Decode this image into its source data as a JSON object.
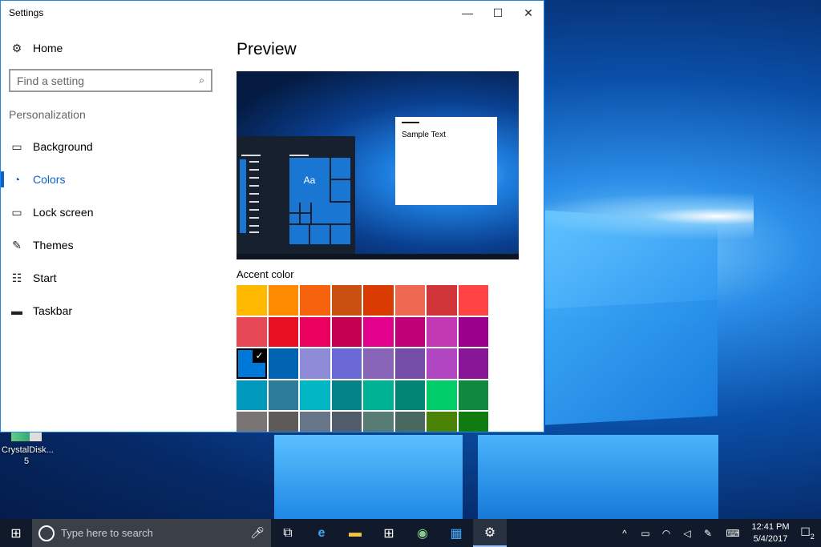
{
  "window": {
    "title": "Settings",
    "minimize": "—",
    "maximize": "☐",
    "close": "✕"
  },
  "sidebar": {
    "home": "Home",
    "search_placeholder": "Find a setting",
    "section": "Personalization",
    "items": [
      {
        "label": "Background",
        "icon": "image-icon"
      },
      {
        "label": "Colors",
        "icon": "palette-icon"
      },
      {
        "label": "Lock screen",
        "icon": "lock-screen-icon"
      },
      {
        "label": "Themes",
        "icon": "brush-icon"
      },
      {
        "label": "Start",
        "icon": "start-icon"
      },
      {
        "label": "Taskbar",
        "icon": "taskbar-icon"
      }
    ],
    "active": "Colors"
  },
  "main": {
    "preview_title": "Preview",
    "sample_text": "Sample Text",
    "tile_text": "Aa",
    "accent_label": "Accent color",
    "accent_colors": [
      "#FFB900",
      "#FF8C00",
      "#F7630C",
      "#CA5010",
      "#DA3B01",
      "#EF6950",
      "#D13438",
      "#FF4343",
      "#E74856",
      "#E81123",
      "#EA005E",
      "#C30052",
      "#E3008C",
      "#BF0077",
      "#C239B3",
      "#9A0089",
      "#0078D7",
      "#0063B1",
      "#8E8CD8",
      "#6B69D6",
      "#8764B8",
      "#744DA9",
      "#B146C2",
      "#881798",
      "#0099BC",
      "#2D7D9A",
      "#00B7C3",
      "#038387",
      "#00B294",
      "#018574",
      "#00CC6A",
      "#10893E",
      "#7A7574",
      "#5D5A58",
      "#68768A",
      "#515C6B",
      "#567C73",
      "#486860",
      "#498205",
      "#107C10"
    ],
    "selected_index": 16
  },
  "desktop": {
    "icon_label_1": "CrystalDisk...",
    "icon_label_2": "5"
  },
  "taskbar": {
    "search_placeholder": "Type here to search",
    "time": "12:41 PM",
    "date": "5/4/2017",
    "notifications": "2"
  }
}
